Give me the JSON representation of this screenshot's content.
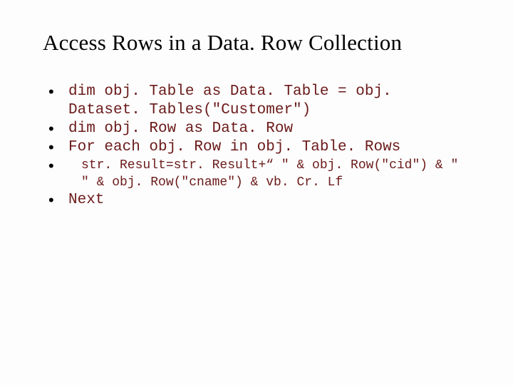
{
  "title": "Access Rows in a Data. Row Collection",
  "bullets": [
    {
      "kind": "code",
      "text": "dim obj. Table as Data. Table = obj. Dataset. Tables(\"Customer\")"
    },
    {
      "kind": "code",
      "text": "dim obj. Row as Data. Row"
    },
    {
      "kind": "code",
      "text": "For each obj. Row in obj. Table. Rows"
    },
    {
      "kind": "code-small",
      "text": "str. Result=str. Result+“ \" & obj. Row(\"cid\") & \" \" & obj. Row(\"cname\") & vb. Cr. Lf"
    },
    {
      "kind": "code",
      "text": "Next"
    }
  ]
}
